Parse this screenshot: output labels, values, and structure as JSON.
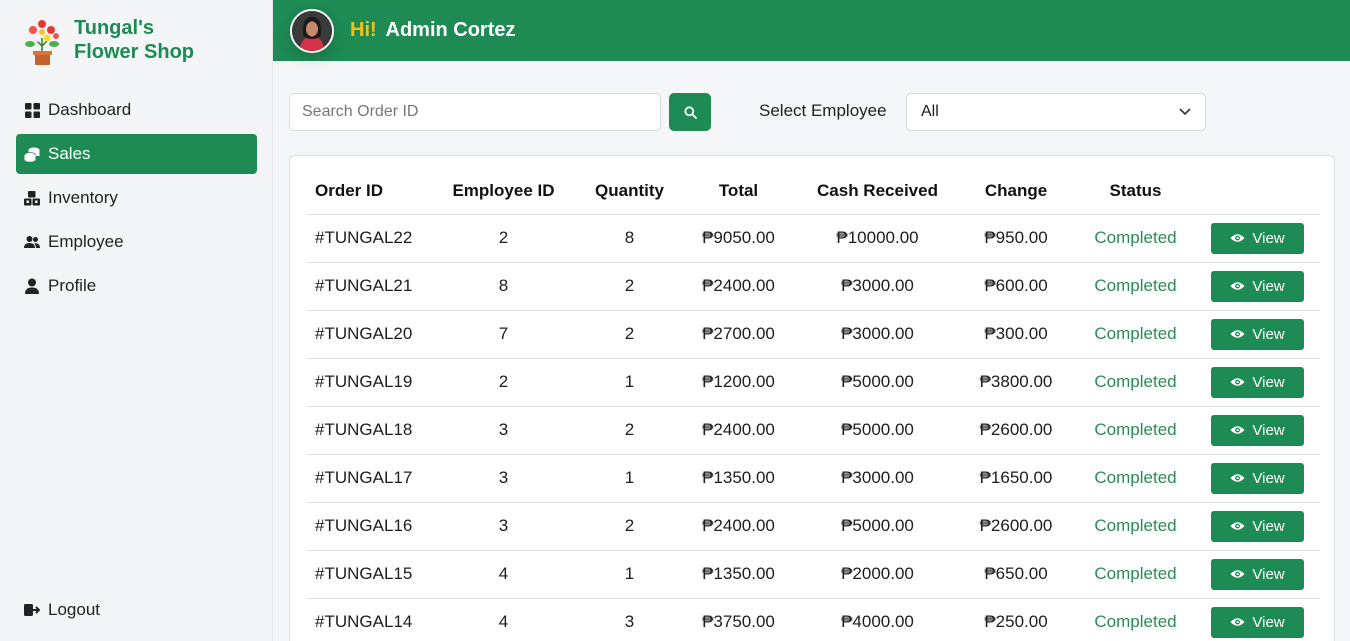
{
  "brand": {
    "line1": "Tungal's",
    "line2": "Flower Shop"
  },
  "nav": [
    {
      "label": "Dashboard",
      "icon": "grid-icon",
      "active": false
    },
    {
      "label": "Sales",
      "icon": "coins-icon",
      "active": true
    },
    {
      "label": "Inventory",
      "icon": "boxes-icon",
      "active": false
    },
    {
      "label": "Employee",
      "icon": "users-icon",
      "active": false
    },
    {
      "label": "Profile",
      "icon": "user-icon",
      "active": false
    }
  ],
  "logout": {
    "label": "Logout",
    "icon": "logout-icon"
  },
  "header": {
    "hi": "Hi!",
    "name": "Admin Cortez"
  },
  "search": {
    "placeholder": "Search Order ID",
    "value": ""
  },
  "filter": {
    "label": "Select Employee",
    "selected": "All"
  },
  "table": {
    "columns": [
      "Order ID",
      "Employee ID",
      "Quantity",
      "Total",
      "Cash Received",
      "Change",
      "Status",
      ""
    ],
    "view_label": "View",
    "rows": [
      [
        "#TUNGAL22",
        "2",
        "8",
        "₱9050.00",
        "₱10000.00",
        "₱950.00",
        "Completed"
      ],
      [
        "#TUNGAL21",
        "8",
        "2",
        "₱2400.00",
        "₱3000.00",
        "₱600.00",
        "Completed"
      ],
      [
        "#TUNGAL20",
        "7",
        "2",
        "₱2700.00",
        "₱3000.00",
        "₱300.00",
        "Completed"
      ],
      [
        "#TUNGAL19",
        "2",
        "1",
        "₱1200.00",
        "₱5000.00",
        "₱3800.00",
        "Completed"
      ],
      [
        "#TUNGAL18",
        "3",
        "2",
        "₱2400.00",
        "₱5000.00",
        "₱2600.00",
        "Completed"
      ],
      [
        "#TUNGAL17",
        "3",
        "1",
        "₱1350.00",
        "₱3000.00",
        "₱1650.00",
        "Completed"
      ],
      [
        "#TUNGAL16",
        "3",
        "2",
        "₱2400.00",
        "₱5000.00",
        "₱2600.00",
        "Completed"
      ],
      [
        "#TUNGAL15",
        "4",
        "1",
        "₱1350.00",
        "₱2000.00",
        "₱650.00",
        "Completed"
      ],
      [
        "#TUNGAL14",
        "4",
        "3",
        "₱3750.00",
        "₱4000.00",
        "₱250.00",
        "Completed"
      ]
    ]
  },
  "colors": {
    "brand": "#1e8a54",
    "accent": "#f3c21a",
    "status_completed": "#2b8a55"
  }
}
